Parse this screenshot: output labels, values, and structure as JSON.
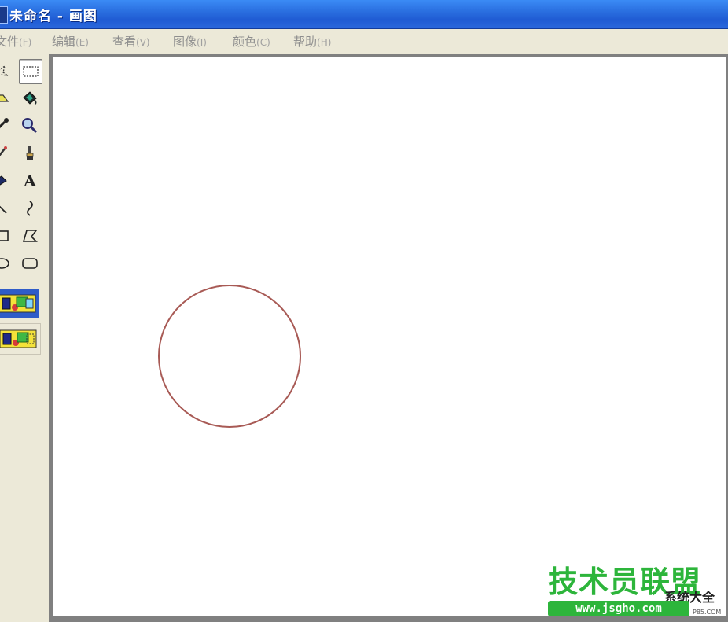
{
  "window": {
    "title": "未命名 - 画图"
  },
  "menu": [
    {
      "label": "文件",
      "accel": "(F)"
    },
    {
      "label": "编辑",
      "accel": "(E)"
    },
    {
      "label": "查看",
      "accel": "(V)"
    },
    {
      "label": "图像",
      "accel": "(I)"
    },
    {
      "label": "颜色",
      "accel": "(C)"
    },
    {
      "label": "帮助",
      "accel": "(H)"
    }
  ],
  "tools": [
    {
      "name": "free-form-select",
      "icon": "star-select-icon"
    },
    {
      "name": "rectangle-select",
      "icon": "rect-select-icon",
      "selected": true
    },
    {
      "name": "eraser",
      "icon": "eraser-icon"
    },
    {
      "name": "fill-with-color",
      "icon": "paint-bucket-icon"
    },
    {
      "name": "pick-color",
      "icon": "eyedropper-icon"
    },
    {
      "name": "magnifier",
      "icon": "magnifier-icon"
    },
    {
      "name": "pencil",
      "icon": "pencil-icon"
    },
    {
      "name": "brush",
      "icon": "brush-icon"
    },
    {
      "name": "airbrush",
      "icon": "airbrush-icon"
    },
    {
      "name": "text",
      "icon": "text-icon",
      "glyph": "A"
    },
    {
      "name": "line",
      "icon": "line-icon"
    },
    {
      "name": "curve",
      "icon": "curve-icon"
    },
    {
      "name": "rectangle",
      "icon": "rectangle-icon"
    },
    {
      "name": "polygon",
      "icon": "polygon-icon"
    },
    {
      "name": "ellipse",
      "icon": "ellipse-icon"
    },
    {
      "name": "rounded-rectangle",
      "icon": "rounded-rect-icon"
    }
  ],
  "tool_options": [
    {
      "name": "opaque-selection",
      "active": true
    },
    {
      "name": "transparent-selection",
      "active": false
    }
  ],
  "canvas": {
    "shape": "circle",
    "stroke_color": "#a85a55"
  },
  "watermark": {
    "title": "技术员联盟",
    "url": "www.jsgho.com",
    "side": "系统大全",
    "side_small": "P85.COM"
  },
  "colors": {
    "titlebar": "#2a6fe0",
    "chrome": "#ece9d8",
    "menu_text": "#8e8e8e",
    "watermark_green": "#2db53b"
  }
}
